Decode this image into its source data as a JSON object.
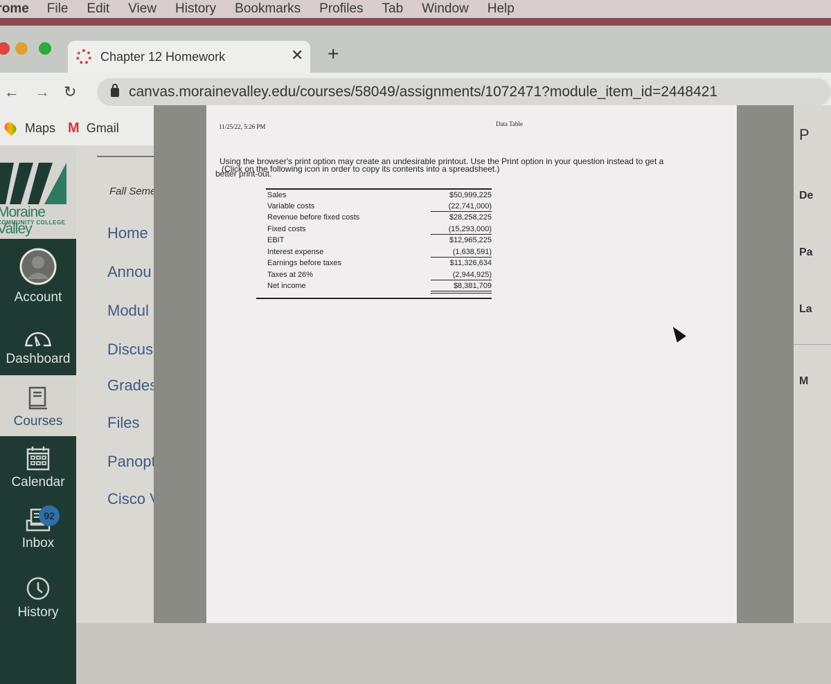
{
  "menubar": {
    "app": "Chrome",
    "items": [
      "File",
      "Edit",
      "View",
      "History",
      "Bookmarks",
      "Profiles",
      "Tab",
      "Window",
      "Help"
    ]
  },
  "tabs": [
    {
      "title": "Chapter 12 Homework",
      "icon": "canvas-icon",
      "active": true
    }
  ],
  "toolbar": {
    "url": "canvas.morainevalley.edu/courses/58049/assignments/1072471?module_item_id=2448421"
  },
  "bookmarks": [
    {
      "label": "Maps",
      "icon": "maps-pin-icon"
    },
    {
      "label": "Gmail",
      "icon": "gmail-icon"
    }
  ],
  "colors": {
    "global_nav_dark": "#1f3a33",
    "brand_green": "#2f7a62",
    "link_blue": "#3e5a86",
    "badge_blue": "#2e6fa8"
  },
  "global_nav": {
    "logo_text": "Moraine Valley",
    "logo_subtext": "COMMUNITY COLLEGE",
    "items": [
      {
        "label": "Account",
        "icon": "account-avatar-icon"
      },
      {
        "label": "Dashboard",
        "icon": "dashboard-gauge-icon"
      },
      {
        "label": "Courses",
        "icon": "courses-book-icon"
      },
      {
        "label": "Calendar",
        "icon": "calendar-icon"
      },
      {
        "label": "Inbox",
        "icon": "inbox-icon",
        "badge": "92"
      },
      {
        "label": "History",
        "icon": "history-clock-icon"
      }
    ]
  },
  "course_nav": {
    "term": "Fall Seme",
    "items": [
      "Home",
      "Annou",
      "Modul",
      "Discus",
      "Grades",
      "Files",
      "Panopt",
      "Cisco V"
    ]
  },
  "print_page": {
    "header_date": "11/25/22, 5:26 PM",
    "header_title": "Data Table",
    "note_line1": "Using the browser's print option may create an undesirable printout. Use the Print option in your question instead to get a",
    "note_line2": "(Click on the following icon       in order to copy its contents into a spreadsheet.)",
    "note_line3": "better print-out.",
    "table": [
      {
        "label": "Sales",
        "value": "$50,999,225"
      },
      {
        "label": "Variable costs",
        "value": "(22,741,000)"
      },
      {
        "label": "Revenue before fixed costs",
        "value": "$28,258,225"
      },
      {
        "label": "Fixed costs",
        "value": "(15,293,000)"
      },
      {
        "label": "EBIT",
        "value": "$12,965,225"
      },
      {
        "label": "Interest expense",
        "value": "(1,638,591)"
      },
      {
        "label": "Earnings before taxes",
        "value": "$11,326,634"
      },
      {
        "label": "Taxes at 26%",
        "value": "(2,944,925)"
      },
      {
        "label": "Net income",
        "value": "$8,381,709"
      }
    ]
  },
  "right_panel": {
    "items": [
      "P",
      "De",
      "Pa",
      "La",
      "M"
    ]
  }
}
